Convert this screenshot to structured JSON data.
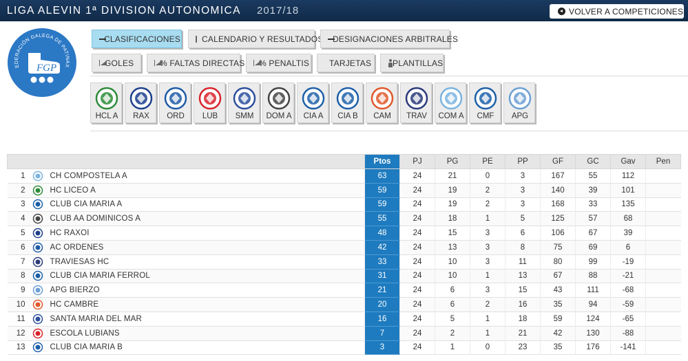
{
  "header": {
    "title": "LIGA ALEVIN 1ª DIVISION AUTONOMICA",
    "season": "2017/18",
    "back_label": "VOLVER A COMPETICIONES"
  },
  "logo": {
    "text": "FEDERACIÓN GALEGA DE PATINAXE",
    "initials": "FGP"
  },
  "nav": {
    "row1": [
      {
        "label": "CLASIFICACIONES",
        "icon": "list-icon",
        "active": true
      },
      {
        "label": "CALENDARIO Y RESULTADOS",
        "icon": "calendar-icon"
      },
      {
        "label": "DESIGNACIONES ARBITRALES",
        "icon": "list-icon"
      }
    ],
    "row2": [
      {
        "label": "GOLES",
        "icon": "area-chart-icon"
      },
      {
        "label": "% FALTAS DIRECTAS",
        "icon": "area-chart-icon"
      },
      {
        "label": "% PENALTIS",
        "icon": "area-chart-icon"
      },
      {
        "label": "TARJETAS",
        "icon": "document-icon"
      },
      {
        "label": "PLANTILLAS",
        "icon": "person-icon"
      }
    ]
  },
  "teams": [
    {
      "code": "HCL A",
      "color": "#2e8b3a"
    },
    {
      "code": "RAX",
      "color": "#1c3f8c"
    },
    {
      "code": "ORD",
      "color": "#1f5aa6"
    },
    {
      "code": "LUB",
      "color": "#d8232a"
    },
    {
      "code": "SMM",
      "color": "#2d4f9e"
    },
    {
      "code": "DOM A",
      "color": "#444444"
    },
    {
      "code": "CIA A",
      "color": "#1d5fa8"
    },
    {
      "code": "CIA B",
      "color": "#1d5fa8"
    },
    {
      "code": "CAM",
      "color": "#e0592a"
    },
    {
      "code": "TRAV",
      "color": "#2a3a7a"
    },
    {
      "code": "COM A",
      "color": "#7ab3df"
    },
    {
      "code": "CMF",
      "color": "#1d5fa8"
    },
    {
      "code": "APG",
      "color": "#6c9fd3"
    }
  ],
  "table": {
    "headers": [
      "Ptos",
      "PJ",
      "PG",
      "PE",
      "PP",
      "GF",
      "GC",
      "Gav",
      "Pen"
    ],
    "rows": [
      {
        "pos": "1",
        "team": "CH COMPOSTELA A",
        "pts": "63",
        "pj": "24",
        "pg": "21",
        "pe": "0",
        "pp": "3",
        "gf": "167",
        "gc": "55",
        "gav": "112",
        "pen": "",
        "color": "#7ab3df"
      },
      {
        "pos": "2",
        "team": "HC LICEO A",
        "pts": "59",
        "pj": "24",
        "pg": "19",
        "pe": "2",
        "pp": "3",
        "gf": "140",
        "gc": "39",
        "gav": "101",
        "pen": "",
        "color": "#2e8b3a"
      },
      {
        "pos": "3",
        "team": "CLUB CIA MARIA A",
        "pts": "59",
        "pj": "24",
        "pg": "19",
        "pe": "2",
        "pp": "3",
        "gf": "168",
        "gc": "33",
        "gav": "135",
        "pen": "",
        "color": "#1d5fa8"
      },
      {
        "pos": "4",
        "team": "CLUB AA DOMINICOS A",
        "pts": "55",
        "pj": "24",
        "pg": "18",
        "pe": "1",
        "pp": "5",
        "gf": "125",
        "gc": "57",
        "gav": "68",
        "pen": "",
        "color": "#444444"
      },
      {
        "pos": "5",
        "team": "HC RAXOI",
        "pts": "48",
        "pj": "24",
        "pg": "15",
        "pe": "3",
        "pp": "6",
        "gf": "106",
        "gc": "67",
        "gav": "39",
        "pen": "",
        "color": "#1c3f8c"
      },
      {
        "pos": "6",
        "team": "AC ORDENES",
        "pts": "42",
        "pj": "24",
        "pg": "13",
        "pe": "3",
        "pp": "8",
        "gf": "75",
        "gc": "69",
        "gav": "6",
        "pen": "",
        "color": "#1f5aa6"
      },
      {
        "pos": "7",
        "team": "TRAVIESAS HC",
        "pts": "33",
        "pj": "24",
        "pg": "10",
        "pe": "3",
        "pp": "11",
        "gf": "80",
        "gc": "99",
        "gav": "-19",
        "pen": "",
        "color": "#2a3a7a"
      },
      {
        "pos": "8",
        "team": "CLUB CIA MARIA FERROL",
        "pts": "31",
        "pj": "24",
        "pg": "10",
        "pe": "1",
        "pp": "13",
        "gf": "67",
        "gc": "88",
        "gav": "-21",
        "pen": "",
        "color": "#1d5fa8"
      },
      {
        "pos": "9",
        "team": "APG BIERZO",
        "pts": "21",
        "pj": "24",
        "pg": "6",
        "pe": "3",
        "pp": "15",
        "gf": "43",
        "gc": "111",
        "gav": "-68",
        "pen": "",
        "color": "#6c9fd3"
      },
      {
        "pos": "10",
        "team": "HC CAMBRE",
        "pts": "20",
        "pj": "24",
        "pg": "6",
        "pe": "2",
        "pp": "16",
        "gf": "35",
        "gc": "94",
        "gav": "-59",
        "pen": "",
        "color": "#e0592a"
      },
      {
        "pos": "11",
        "team": "SANTA MARIA DEL MAR",
        "pts": "16",
        "pj": "24",
        "pg": "5",
        "pe": "1",
        "pp": "18",
        "gf": "59",
        "gc": "124",
        "gav": "-65",
        "pen": "",
        "color": "#2d4f9e"
      },
      {
        "pos": "12",
        "team": "ESCOLA LUBIANS",
        "pts": "7",
        "pj": "24",
        "pg": "2",
        "pe": "1",
        "pp": "21",
        "gf": "42",
        "gc": "130",
        "gav": "-88",
        "pen": "",
        "color": "#d8232a"
      },
      {
        "pos": "13",
        "team": "CLUB CIA MARIA B",
        "pts": "3",
        "pj": "24",
        "pg": "1",
        "pe": "0",
        "pp": "23",
        "gf": "35",
        "gc": "176",
        "gav": "-141",
        "pen": "",
        "color": "#1d5fa8"
      }
    ]
  }
}
